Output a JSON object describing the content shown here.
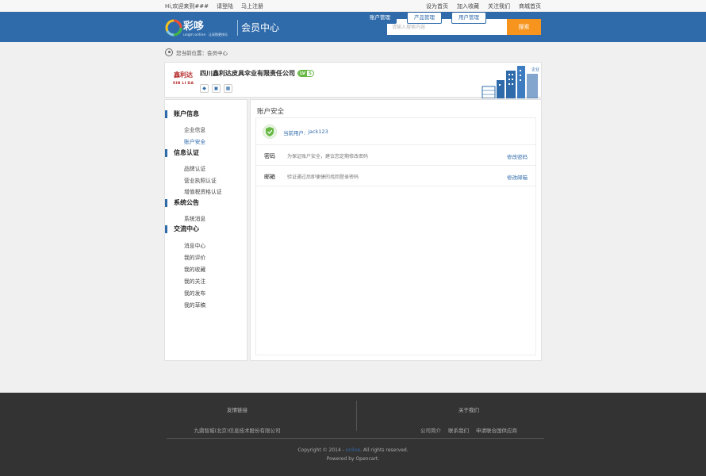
{
  "topbar": {
    "welcome": "Hi,欢迎来到###",
    "login": "请登陆",
    "register": "马上注册",
    "links": [
      "设为首页",
      "加入收藏",
      "关注我们",
      "商城首页"
    ]
  },
  "header": {
    "logo_text": "彩哆",
    "logo_domain": "ungm.online",
    "logo_tagline": "让采购更快乐",
    "title": "会员中心",
    "search_placeholder": "请输入搜索内容",
    "search_button": "搜索"
  },
  "breadcrumb": "您当前位置：会员中心",
  "company": {
    "logo_mark": "鑫利达",
    "logo_en": "XIN LI DA",
    "name": "四川鑫利达皮具伞业有限责任公司",
    "level_tag": "LV",
    "level": "5",
    "actions": [
      "账户管理",
      "产品管理",
      "用户管理"
    ],
    "building_text": "企业"
  },
  "sidebar": {
    "groups": [
      {
        "title": "账户信息",
        "items": [
          "企业信息",
          "账户安全"
        ]
      },
      {
        "title": "信息认证",
        "items": [
          "品牌认证",
          "营业执照认证",
          "增值税资格认证"
        ]
      },
      {
        "title": "系统公告",
        "items": [
          "系统消息"
        ]
      },
      {
        "title": "交流中心",
        "items": [
          "消息中心",
          "我的评价",
          "我的收藏",
          "我的关注",
          "我的发布",
          "我的草稿"
        ]
      }
    ],
    "active": "账户安全"
  },
  "main": {
    "title": "账户安全",
    "user_label": "当前用户:",
    "user_value": "jack123",
    "rows": [
      {
        "label": "密码",
        "desc": "为保证账户安全，建议您定期修改密码",
        "action": "修改密码"
      },
      {
        "label": "邮箱",
        "desc": "验证通过后即便捷的找回登录密码",
        "action": "修改邮箱"
      }
    ]
  },
  "footer": {
    "friend_links_title": "友情链接",
    "friend_link": "九鼎智城(北京)信息技术股份有限公司",
    "about_title": "关于我们",
    "about_links": [
      "公司简介",
      "联系我们",
      "申请联合国供应商"
    ],
    "copyright_pre": "Copyright © 2014 -",
    "copyright_hl": "online",
    "copyright_post": ". All rights reserved.",
    "powered": "Powered by Opencart."
  },
  "colors": {
    "brand_blue": "#2f6bab",
    "search_orange": "#f7941d",
    "level_green": "#67b843",
    "footer_bg": "#333333"
  }
}
